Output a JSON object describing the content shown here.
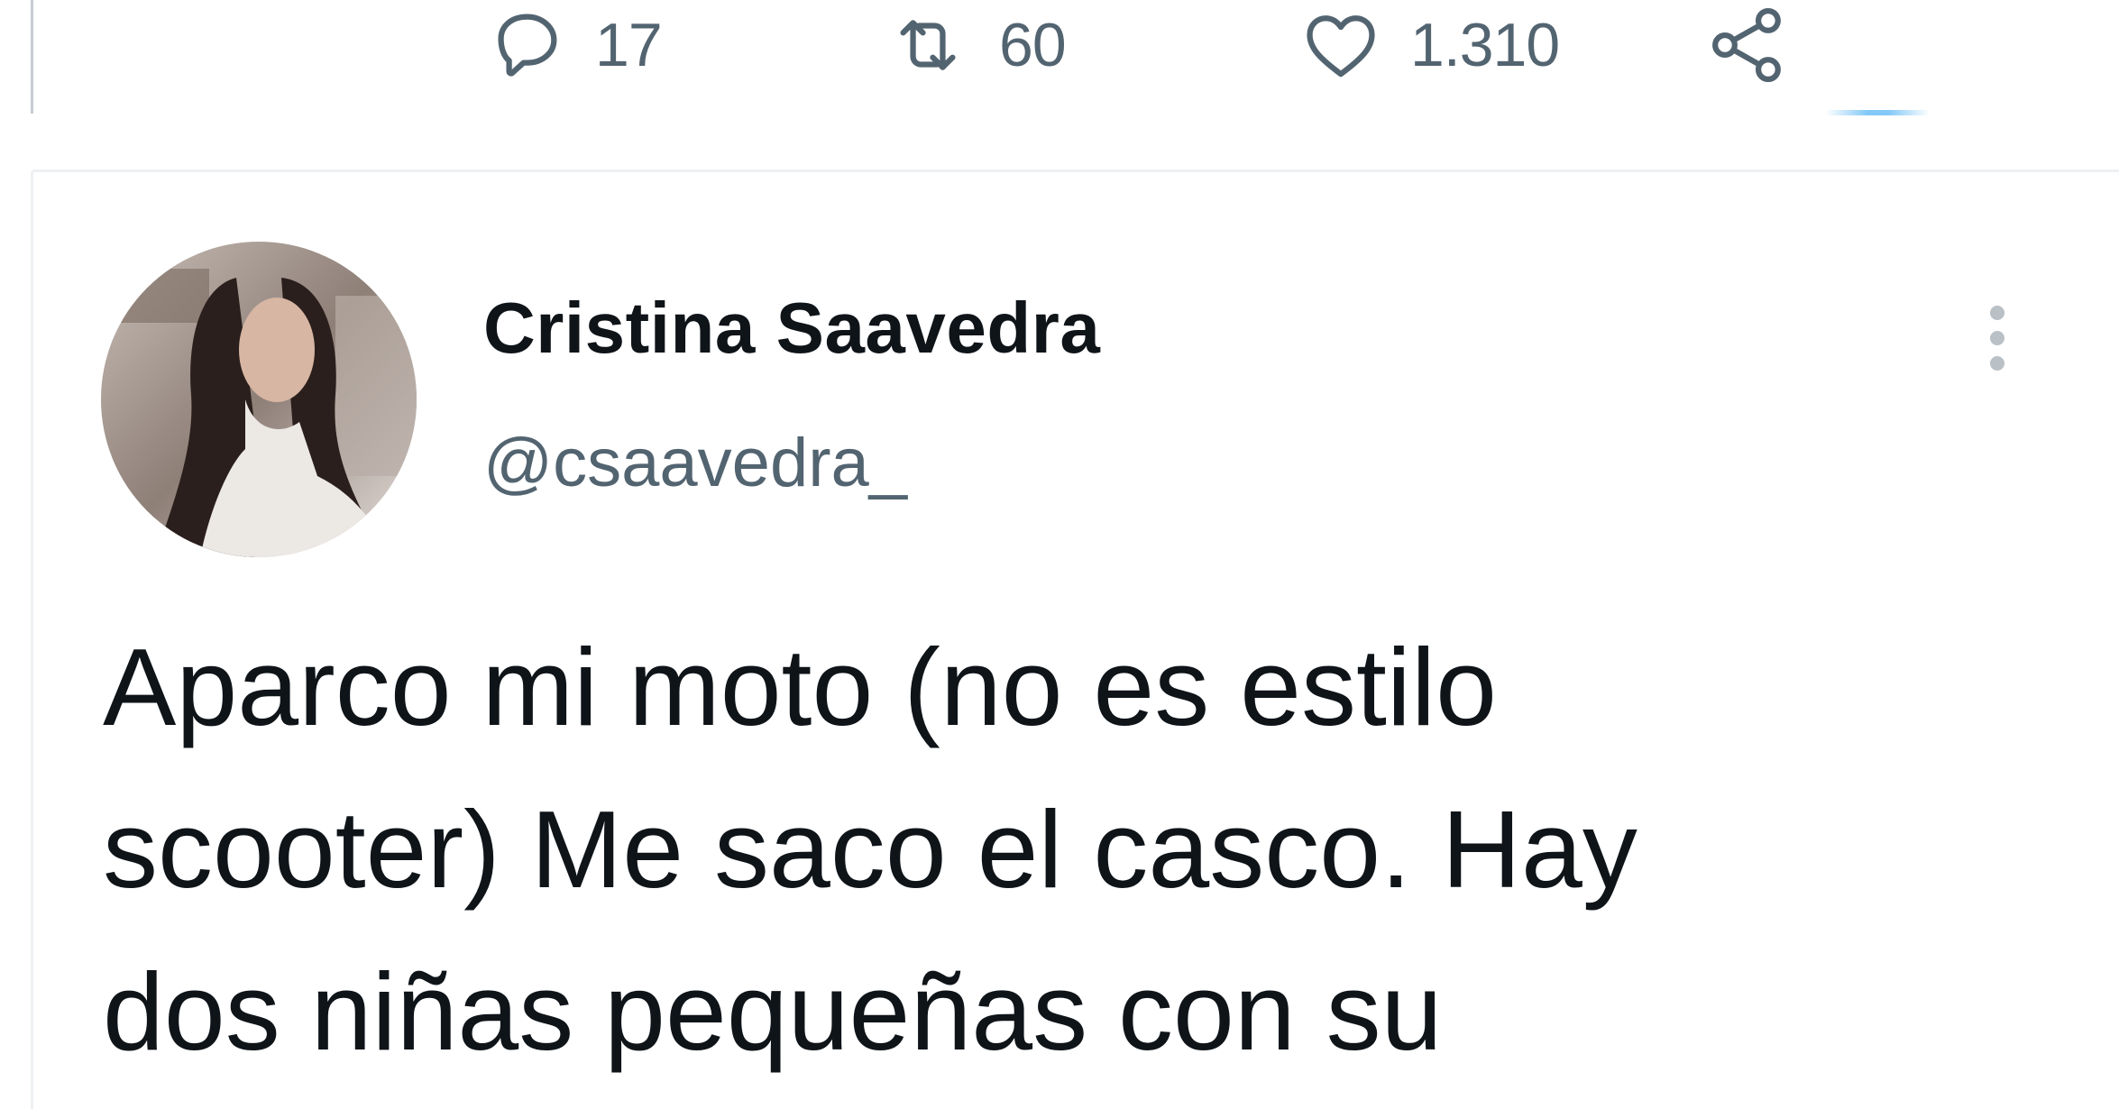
{
  "previous_tweet": {
    "actions": {
      "reply": {
        "icon": "reply-icon",
        "count": "17"
      },
      "retweet": {
        "icon": "retweet-icon",
        "count": "60"
      },
      "like": {
        "icon": "heart-icon",
        "count": "1.310"
      },
      "share": {
        "icon": "share-icon"
      }
    }
  },
  "tweet": {
    "author": {
      "display_name": "Cristina Saavedra",
      "handle": "@csaavedra_",
      "avatar": "profile-photo"
    },
    "more_icon": "more-vertical-icon",
    "text_lines": [
      "Aparco mi moto (no es estilo",
      "scooter) Me saco el casco. Hay",
      "dos niñas pequeñas con su"
    ]
  },
  "colors": {
    "text_primary": "#0f1419",
    "text_secondary": "#536471",
    "divider": "#eef1f3",
    "accent": "#1d9bf0"
  }
}
